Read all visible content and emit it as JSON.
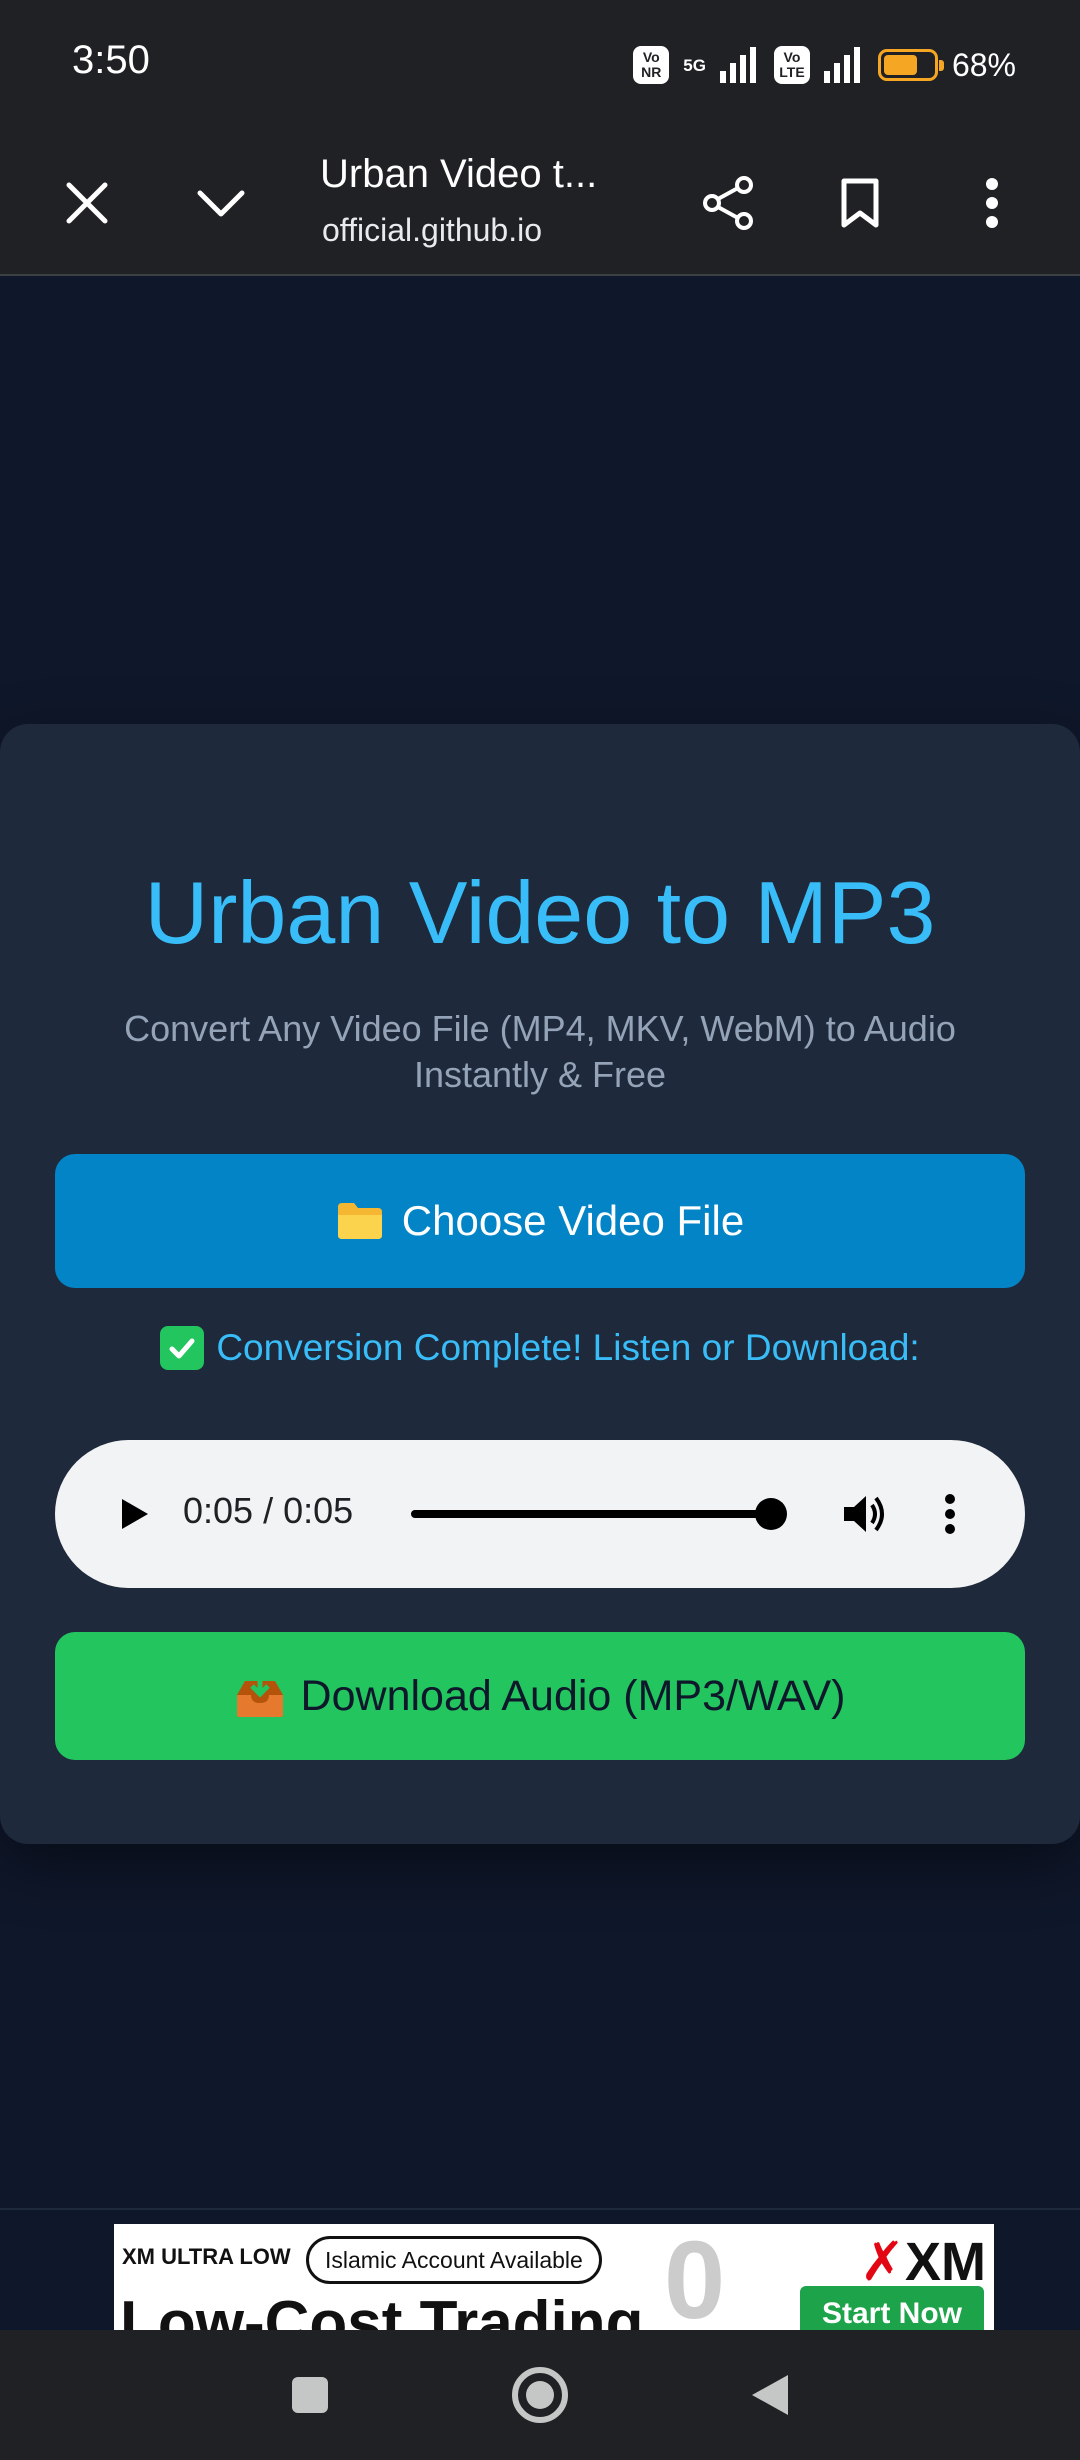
{
  "status_bar": {
    "time": "3:50",
    "badge_1": "Vo NR",
    "network": "5G",
    "badge_2": "Vo LTE",
    "battery_text": "68%",
    "battery_level": 0.68,
    "battery_color": "#f5a623"
  },
  "browser": {
    "page_title": "Urban Video t...",
    "url": "official.github.io",
    "icons": [
      "close-icon",
      "chevron-down-icon",
      "share-icon",
      "bookmark-icon",
      "more-vert-icon"
    ]
  },
  "app": {
    "title": "Urban Video to MP3",
    "subtitle": "Convert Any Video File (MP4, MKV, WebM) to Audio Instantly & Free",
    "choose_button": "Choose Video File",
    "choose_icon": "folder-icon",
    "status_message": "Conversion Complete! Listen or Download:",
    "status_icon": "check-icon",
    "player": {
      "time_display": "0:05 / 0:05",
      "progress": 1.0
    },
    "download_button": "Download Audio (MP3/WAV)",
    "download_icon": "inbox-tray-icon",
    "colors": {
      "accent": "#38bdf8",
      "primary_button": "#0284c7",
      "success_button": "#22c55e",
      "card": "#1e293b",
      "background": "#0f172a"
    }
  },
  "ad": {
    "label": "XM ULTRA LOW",
    "pill": "Islamic Account Available",
    "headline": "Low-Cost Trading",
    "brand": "XM",
    "cta": "Start Now"
  },
  "nav_bar": {
    "icons": [
      "recents-square-icon",
      "home-circle-icon",
      "back-triangle-icon"
    ]
  }
}
